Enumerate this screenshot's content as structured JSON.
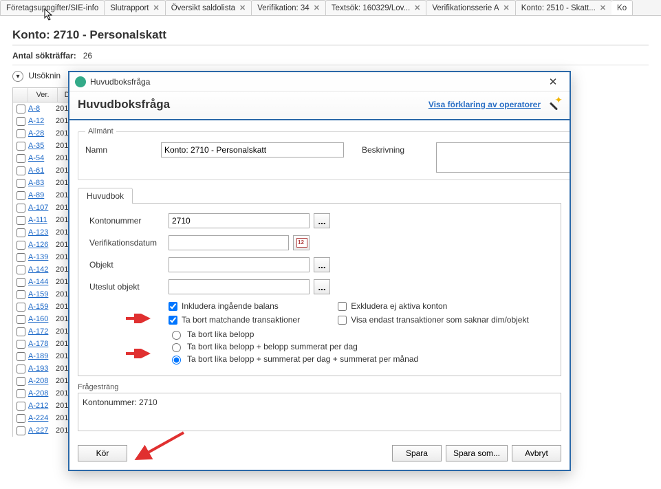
{
  "tabs": [
    {
      "label": "Företagsuppgifter/SIE-info"
    },
    {
      "label": "Slutrapport"
    },
    {
      "label": "Översikt saldolista"
    },
    {
      "label": "Verifikation: 34"
    },
    {
      "label": "Textsök: 160329/Lov..."
    },
    {
      "label": "Verifikationsserie A"
    },
    {
      "label": "Konto: 2510 - Skatt..."
    },
    {
      "label": "Ko"
    }
  ],
  "page": {
    "title": "Konto: 2710 - Personalskatt",
    "count_label": "Antal sökträffar:",
    "count_value": "26",
    "utsok_label": "Utsöknin"
  },
  "grid": {
    "headers": {
      "ver": "Ver.",
      "dat": "D"
    },
    "rows": [
      {
        "ver": "A-8",
        "dat": "201"
      },
      {
        "ver": "A-12",
        "dat": "201"
      },
      {
        "ver": "A-28",
        "dat": "201"
      },
      {
        "ver": "A-35",
        "dat": "201"
      },
      {
        "ver": "A-54",
        "dat": "201"
      },
      {
        "ver": "A-61",
        "dat": "201"
      },
      {
        "ver": "A-83",
        "dat": "201"
      },
      {
        "ver": "A-89",
        "dat": "201"
      },
      {
        "ver": "A-107",
        "dat": "201"
      },
      {
        "ver": "A-111",
        "dat": "201"
      },
      {
        "ver": "A-123",
        "dat": "201"
      },
      {
        "ver": "A-126",
        "dat": "201"
      },
      {
        "ver": "A-139",
        "dat": "201"
      },
      {
        "ver": "A-142",
        "dat": "201"
      },
      {
        "ver": "A-144",
        "dat": "201"
      },
      {
        "ver": "A-159",
        "dat": "201"
      },
      {
        "ver": "A-159",
        "dat": "201"
      },
      {
        "ver": "A-160",
        "dat": "201"
      },
      {
        "ver": "A-172",
        "dat": "201"
      },
      {
        "ver": "A-178",
        "dat": "201"
      },
      {
        "ver": "A-189",
        "dat": "201"
      },
      {
        "ver": "A-193",
        "dat": "201"
      },
      {
        "ver": "A-208",
        "dat": "201"
      },
      {
        "ver": "A-208",
        "dat": "201"
      },
      {
        "ver": "A-212",
        "dat": "201"
      },
      {
        "ver": "A-224",
        "dat": "201"
      },
      {
        "ver": "A-227",
        "dat": "201"
      }
    ]
  },
  "dialog": {
    "titlebar": "Huvudboksfråga",
    "heading": "Huvudboksfråga",
    "link": "Visa förklaring av operatorer",
    "allmant_legend": "Allmänt",
    "name_label": "Namn",
    "name_value": "Konto: 2710 - Personalskatt",
    "desc_label": "Beskrivning",
    "desc_value": "",
    "inner_tab": "Huvudbok",
    "kontonr_label": "Kontonummer",
    "kontonr_value": "2710",
    "verdate_label": "Verifikationsdatum",
    "verdate_value": "",
    "objekt_label": "Objekt",
    "objekt_value": "",
    "uteslut_label": "Uteslut objekt",
    "uteslut_value": "",
    "chk1": "Inkludera ingående balans",
    "chk2": "Exkludera ej aktiva konton",
    "chk3": "Ta bort matchande transaktioner",
    "chk4": "Visa endast transaktioner som saknar dim/objekt",
    "r1": "Ta bort lika belopp",
    "r2": "Ta bort lika belopp + belopp summerat per dag",
    "r3": "Ta bort lika belopp + summerat per dag + summerat per månad",
    "frage_label": "Frågesträng",
    "frage_value": "Kontonummer: 2710",
    "btn_kor": "Kör",
    "btn_spara": "Spara",
    "btn_sparasom": "Spara som...",
    "btn_avbryt": "Avbryt",
    "ellipsis": "..."
  }
}
